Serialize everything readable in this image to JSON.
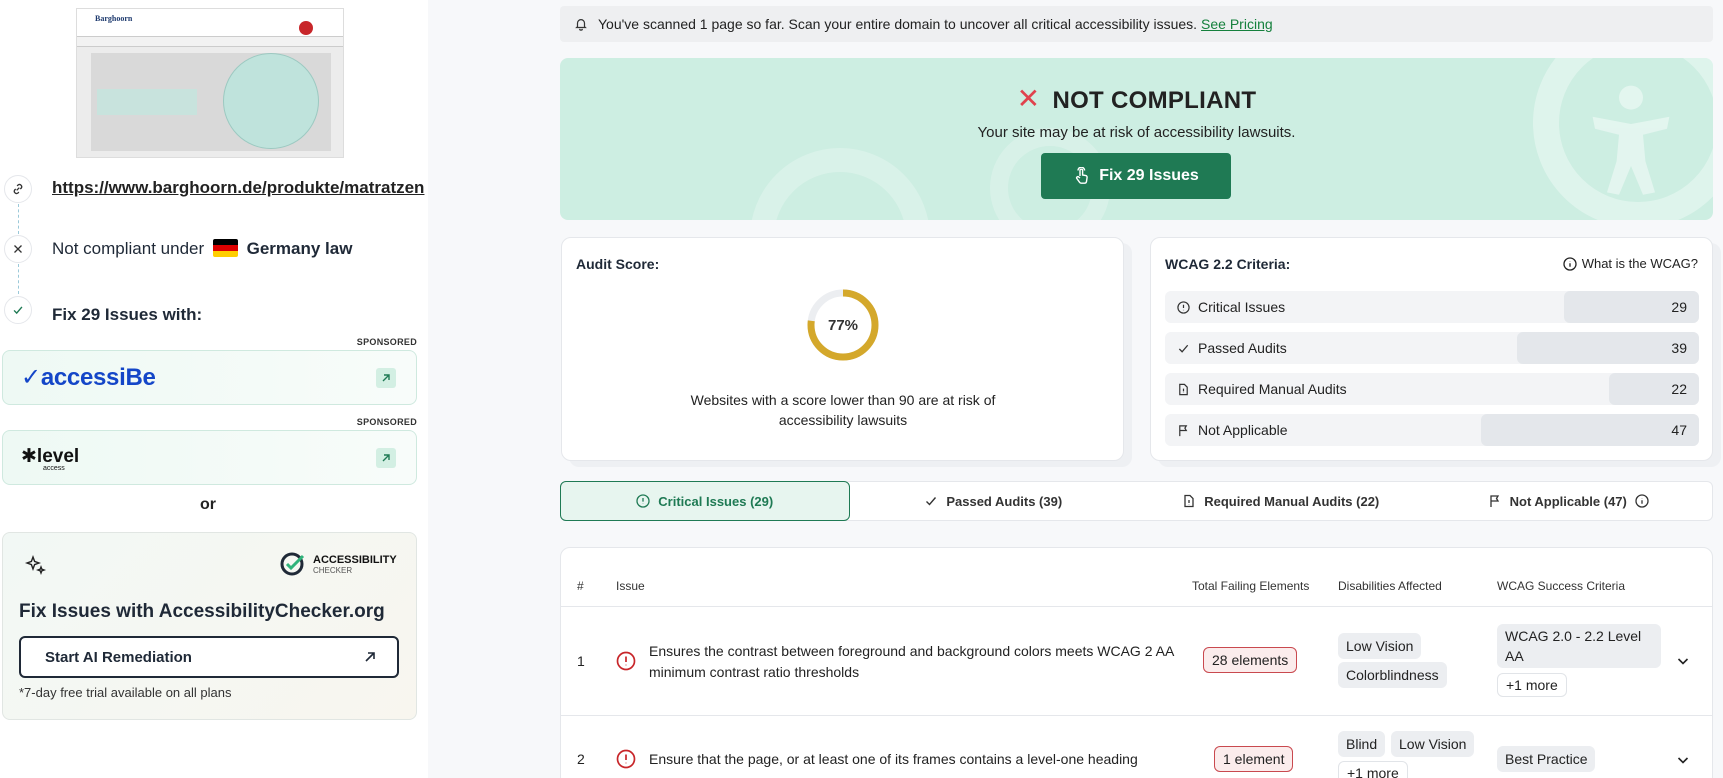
{
  "left": {
    "url": "https://www.barghoorn.de/produkte/matratzen",
    "compliance_prefix": "Not compliant under",
    "compliance_country": "Germany law",
    "fix_heading": "Fix 29 Issues with:",
    "sponsored_label": "SPONSORED",
    "sponsor1_name": "accessiBe",
    "sponsor2_name": "level",
    "sponsor2_sub": "access",
    "or_label": "or",
    "ac_logo_line1": "ACCESSIBILITY",
    "ac_logo_line2": "CHECKER",
    "ac_title": "Fix Issues with AccessibilityChecker.org",
    "ac_button": "Start AI Remediation",
    "ac_note": "*7-day free trial available on all plans"
  },
  "banner": {
    "text": "You've scanned 1 page so far. Scan your entire domain to uncover all critical accessibility issues.",
    "link": "See Pricing"
  },
  "hero": {
    "title": "NOT COMPLIANT",
    "subtitle": "Your site may be at risk of accessibility lawsuits.",
    "button": "Fix 29 Issues"
  },
  "audit": {
    "title": "Audit Score:",
    "score": 77,
    "score_label": "77%",
    "note": "Websites with a score lower than 90 are at risk of accessibility lawsuits"
  },
  "wcag": {
    "title": "WCAG 2.2 Criteria:",
    "help": "What is the WCAG?",
    "rows": [
      {
        "label": "Critical Issues",
        "value": "29"
      },
      {
        "label": "Passed Audits",
        "value": "39"
      },
      {
        "label": "Required Manual Audits",
        "value": "22"
      },
      {
        "label": "Not Applicable",
        "value": "47"
      }
    ]
  },
  "tabs": [
    {
      "label": "Critical Issues (29)"
    },
    {
      "label": "Passed Audits (39)"
    },
    {
      "label": "Required Manual Audits (22)"
    },
    {
      "label": "Not Applicable (47)"
    }
  ],
  "table": {
    "headers": {
      "num": "#",
      "issue": "Issue",
      "failing": "Total Failing Elements",
      "disabilities": "Disabilities Affected",
      "criteria": "WCAG Success Criteria"
    },
    "rows": [
      {
        "num": "1",
        "issue": "Ensures the contrast between foreground and background colors meets WCAG 2 AA minimum contrast ratio thresholds",
        "elements": "28 elements",
        "disabilities": [
          "Low Vision",
          "Colorblindness"
        ],
        "criteria": "WCAG 2.0 - 2.2 Level AA",
        "criteria_more": "+1 more"
      },
      {
        "num": "2",
        "issue": "Ensure that the page, or at least one of its frames contains a level-one heading",
        "elements": "1 element",
        "disabilities": [
          "Blind",
          "Low Vision"
        ],
        "disabilities_more": "+1 more",
        "criteria": "Best Practice"
      }
    ]
  },
  "colors": {
    "accent": "#1f7a54",
    "hero_bg": "#cdeee2",
    "danger": "#c9494f",
    "donut": "#d4a82b"
  }
}
